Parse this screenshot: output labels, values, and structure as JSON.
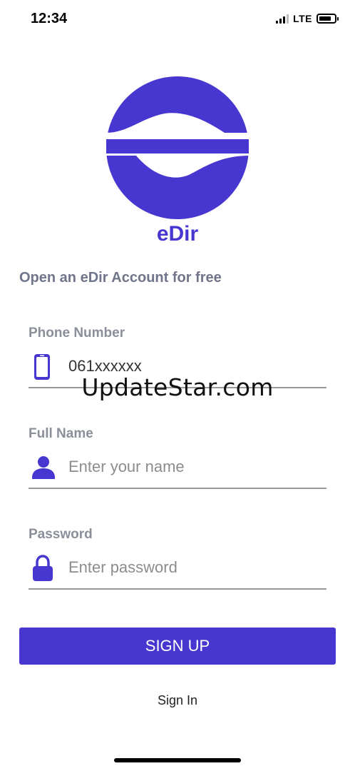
{
  "status_bar": {
    "time": "12:34",
    "network": "LTE",
    "battery_level": 0.8
  },
  "brand": {
    "name": "eDir",
    "color": "#4736cf",
    "logo_icon": "edir-logo-icon"
  },
  "subtitle": "Open an eDir Account for free",
  "form": {
    "phone": {
      "label": "Phone Number",
      "value": "061xxxxxx",
      "placeholder": "",
      "icon": "mobile-phone-icon"
    },
    "full_name": {
      "label": "Full Name",
      "value": "",
      "placeholder": "Enter your name",
      "icon": "person-icon"
    },
    "password": {
      "label": "Password",
      "value": "",
      "placeholder": "Enter password",
      "icon": "lock-icon"
    }
  },
  "watermark": "UpdateStar.com",
  "buttons": {
    "sign_up": "SIGN UP",
    "sign_in": "Sign In"
  }
}
